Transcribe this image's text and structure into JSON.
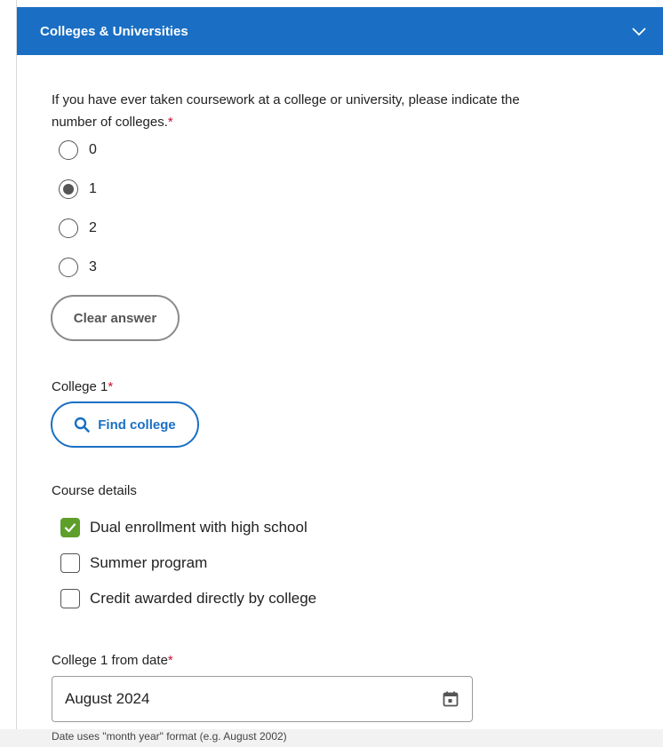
{
  "section": {
    "title": "Colleges & Universities"
  },
  "question": {
    "text": "If you have ever taken coursework at a college or university, please indicate the number of colleges.",
    "required_mark": "*"
  },
  "radio_options": [
    {
      "label": "0",
      "selected": false
    },
    {
      "label": "1",
      "selected": true
    },
    {
      "label": "2",
      "selected": false
    },
    {
      "label": "3",
      "selected": false
    }
  ],
  "clear_button": {
    "label": "Clear answer"
  },
  "college": {
    "label": "College 1",
    "required_mark": "*",
    "find_button": "Find college"
  },
  "course_details": {
    "label": "Course details",
    "options": [
      {
        "label": "Dual enrollment with high school",
        "checked": true
      },
      {
        "label": "Summer program",
        "checked": false
      },
      {
        "label": "Credit awarded directly by college",
        "checked": false
      }
    ]
  },
  "from_date": {
    "label": "College 1 from date",
    "required_mark": "*",
    "value": "August 2024",
    "hint": "Date uses \"month year\" format (e.g. August 2002)"
  },
  "colors": {
    "header_blue": "#1a6fc4",
    "required_red": "#c8102e",
    "checkbox_green": "#5e9e2b"
  },
  "icons": {
    "header": "chevron-down-icon",
    "find": "search-icon",
    "date": "calendar-icon",
    "check": "checkmark-icon"
  }
}
